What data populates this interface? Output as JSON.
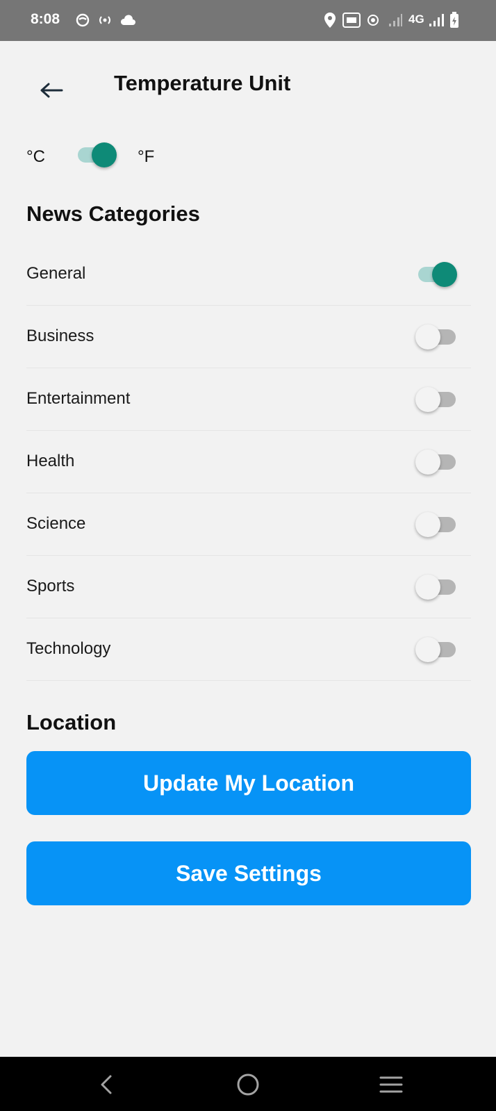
{
  "status_bar": {
    "time": "8:08",
    "network_label": "4G"
  },
  "header": {
    "title": "Temperature Unit"
  },
  "temperature": {
    "celsius_label": "°C",
    "fahrenheit_label": "°F",
    "selected": "°F"
  },
  "news": {
    "title": "News Categories",
    "categories": [
      {
        "label": "General",
        "enabled": true
      },
      {
        "label": "Business",
        "enabled": false
      },
      {
        "label": "Entertainment",
        "enabled": false
      },
      {
        "label": "Health",
        "enabled": false
      },
      {
        "label": "Science",
        "enabled": false
      },
      {
        "label": "Sports",
        "enabled": false
      },
      {
        "label": "Technology",
        "enabled": false
      }
    ]
  },
  "location": {
    "title": "Location",
    "update_button": "Update My Location"
  },
  "actions": {
    "save_button": "Save Settings"
  },
  "colors": {
    "accent": "#0793f6",
    "switch_on": "#0e8a77",
    "background": "#f2f2f2"
  }
}
